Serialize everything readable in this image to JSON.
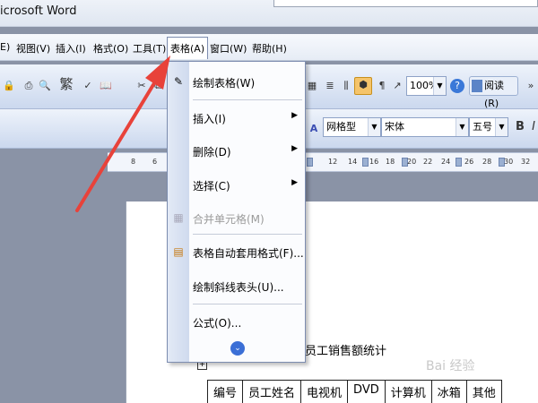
{
  "window": {
    "title": "icrosoft Word"
  },
  "menubar": {
    "items": [
      {
        "label": "E)"
      },
      {
        "label": "视图(V)"
      },
      {
        "label": "插入(I)"
      },
      {
        "label": "格式(O)"
      },
      {
        "label": "工具(T)"
      },
      {
        "label": "表格(A)"
      },
      {
        "label": "窗口(W)"
      },
      {
        "label": "帮助(H)"
      }
    ]
  },
  "toolbar": {
    "traditional_char": "繁",
    "zoom": "100%",
    "read_label": "阅读(R)",
    "style_value": "网格型",
    "font_value": "宋体",
    "size_value": "五号",
    "bold_label": "B",
    "italic_label": "I"
  },
  "ruler": {
    "ticks": [
      "8",
      "6",
      "12",
      "14",
      "16",
      "18",
      "20",
      "22",
      "24",
      "26",
      "28",
      "30",
      "32"
    ]
  },
  "dropdown": {
    "items": [
      {
        "label": "绘制表格(W)"
      },
      {
        "label": "插入(I)"
      },
      {
        "label": "删除(D)"
      },
      {
        "label": "选择(C)"
      },
      {
        "label": "合并单元格(M)"
      },
      {
        "label": "表格自动套用格式(F)..."
      },
      {
        "label": "绘制斜线表头(U)..."
      },
      {
        "label": "公式(O)..."
      }
    ]
  },
  "document": {
    "title": "员工销售额统计",
    "table_headers": [
      "编号",
      "员工姓名",
      "电视机",
      "DVD",
      "计算机",
      "冰箱",
      "其他"
    ]
  },
  "watermark": "Bai 经验",
  "colors": {
    "arrow": "#e8423a",
    "menu_highlight": "#ffffff",
    "toolbar": "#cbd8ee"
  }
}
